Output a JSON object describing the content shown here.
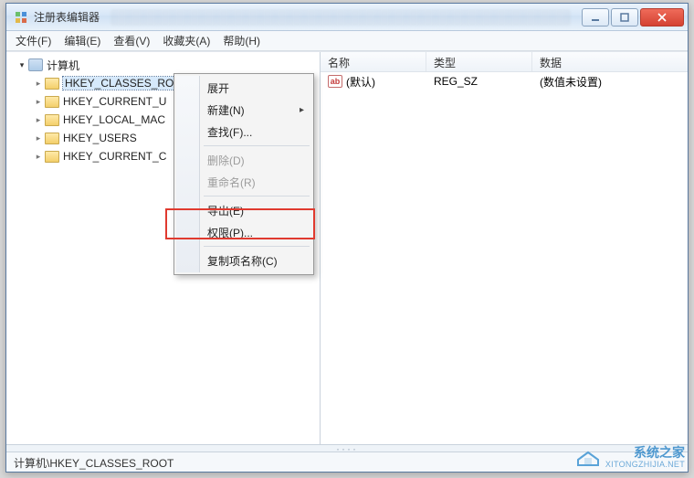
{
  "window": {
    "title": "注册表编辑器"
  },
  "menubar": {
    "file": "文件(F)",
    "edit": "编辑(E)",
    "view": "查看(V)",
    "favorites": "收藏夹(A)",
    "help": "帮助(H)"
  },
  "tree": {
    "root": "计算机",
    "items": [
      "HKEY_CLASSES_ROOT",
      "HKEY_CURRENT_U",
      "HKEY_LOCAL_MAC",
      "HKEY_USERS",
      "HKEY_CURRENT_C"
    ],
    "selected_index": 0
  },
  "list": {
    "columns": {
      "name": "名称",
      "type": "类型",
      "data": "数据"
    },
    "rows": [
      {
        "icon_text": "ab",
        "name": "(默认)",
        "type": "REG_SZ",
        "data": "(数值未设置)"
      }
    ]
  },
  "context_menu": {
    "expand": "展开",
    "new": "新建(N)",
    "find": "查找(F)...",
    "delete": "删除(D)",
    "rename": "重命名(R)",
    "export": "导出(E)",
    "permissions": "权限(P)...",
    "copykeyname": "复制项名称(C)"
  },
  "statusbar": {
    "path": "计算机\\HKEY_CLASSES_ROOT"
  },
  "watermark": {
    "cn": "系统之家",
    "url": "XITONGZHIJIA.NET"
  }
}
